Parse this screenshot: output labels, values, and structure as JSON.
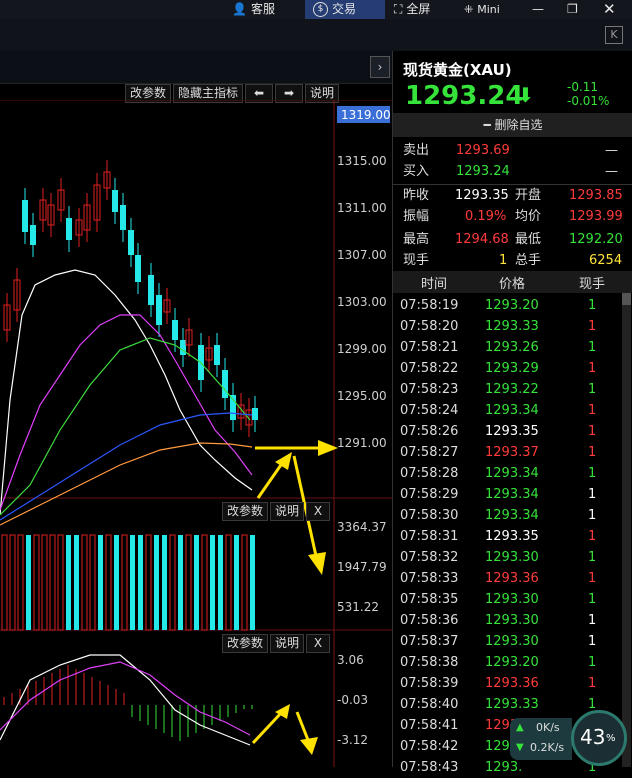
{
  "topbar": {
    "service_label": "客服",
    "trade_label": "交易",
    "fullscreen_label": "全屏",
    "mini_label": "Mini"
  },
  "chart": {
    "toolbar": {
      "params": "改参数",
      "hide_indicator": "隐藏主指标",
      "help": "说明"
    },
    "price_ticks": [
      "1319.00",
      "1315.00",
      "1311.00",
      "1307.00",
      "1303.00",
      "1299.00",
      "1295.00",
      "1291.00"
    ],
    "volume_toolbar": {
      "params": "改参数",
      "help": "说明",
      "close": "X"
    },
    "volume_ticks": [
      "3364.37",
      "1947.79",
      "531.22"
    ],
    "macd_toolbar": {
      "params": "改参数",
      "help": "说明",
      "close": "X"
    },
    "macd_ticks": [
      "3.06",
      "-0.03",
      "-3.12"
    ]
  },
  "quote": {
    "name": "现货黄金(XAU)",
    "price": "1293.24",
    "change": "-0.11",
    "change_pct": "-0.01%",
    "remove_watch": "删除自选",
    "ask_label": "卖出",
    "ask": "1293.69",
    "ask_vol": "—",
    "bid_label": "买入",
    "bid": "1293.24",
    "bid_vol": "—",
    "prev_close_label": "昨收",
    "prev_close": "1293.35",
    "open_label": "开盘",
    "open": "1293.85",
    "amplitude_label": "振幅",
    "amplitude": "0.19%",
    "avg_label": "均价",
    "avg": "1293.99",
    "high_label": "最高",
    "high": "1294.68",
    "low_label": "最低",
    "low": "1292.20",
    "cur_vol_label": "现手",
    "cur_vol": "1",
    "total_vol_label": "总手",
    "total_vol": "6254"
  },
  "trades": {
    "headers": [
      "时间",
      "价格",
      "现手"
    ],
    "rows": [
      {
        "time": "07:58:19",
        "price": "1293.20",
        "vol": "1",
        "pc": "grn",
        "vc": "grn"
      },
      {
        "time": "07:58:20",
        "price": "1293.33",
        "vol": "1",
        "pc": "grn",
        "vc": "red"
      },
      {
        "time": "07:58:21",
        "price": "1293.26",
        "vol": "1",
        "pc": "grn",
        "vc": "grn"
      },
      {
        "time": "07:58:22",
        "price": "1293.29",
        "vol": "1",
        "pc": "grn",
        "vc": "red"
      },
      {
        "time": "07:58:23",
        "price": "1293.22",
        "vol": "1",
        "pc": "grn",
        "vc": "grn"
      },
      {
        "time": "07:58:24",
        "price": "1293.34",
        "vol": "1",
        "pc": "grn",
        "vc": "red"
      },
      {
        "time": "07:58:26",
        "price": "1293.35",
        "vol": "1",
        "pc": "wht",
        "vc": "red"
      },
      {
        "time": "07:58:27",
        "price": "1293.37",
        "vol": "1",
        "pc": "red",
        "vc": "red"
      },
      {
        "time": "07:58:28",
        "price": "1293.34",
        "vol": "1",
        "pc": "grn",
        "vc": "grn"
      },
      {
        "time": "07:58:29",
        "price": "1293.34",
        "vol": "1",
        "pc": "grn",
        "vc": "wht"
      },
      {
        "time": "07:58:30",
        "price": "1293.34",
        "vol": "1",
        "pc": "grn",
        "vc": "wht"
      },
      {
        "time": "07:58:31",
        "price": "1293.35",
        "vol": "1",
        "pc": "wht",
        "vc": "red"
      },
      {
        "time": "07:58:32",
        "price": "1293.30",
        "vol": "1",
        "pc": "grn",
        "vc": "grn"
      },
      {
        "time": "07:58:33",
        "price": "1293.36",
        "vol": "1",
        "pc": "red",
        "vc": "red"
      },
      {
        "time": "07:58:35",
        "price": "1293.30",
        "vol": "1",
        "pc": "grn",
        "vc": "grn"
      },
      {
        "time": "07:58:36",
        "price": "1293.30",
        "vol": "1",
        "pc": "grn",
        "vc": "wht"
      },
      {
        "time": "07:58:37",
        "price": "1293.30",
        "vol": "1",
        "pc": "grn",
        "vc": "wht"
      },
      {
        "time": "07:58:38",
        "price": "1293.20",
        "vol": "1",
        "pc": "grn",
        "vc": "grn"
      },
      {
        "time": "07:58:39",
        "price": "1293.36",
        "vol": "1",
        "pc": "red",
        "vc": "red"
      },
      {
        "time": "07:58:40",
        "price": "1293.33",
        "vol": "1",
        "pc": "grn",
        "vc": "grn"
      },
      {
        "time": "07:58:41",
        "price": "1293.37",
        "vol": "",
        "pc": "red",
        "vc": "red"
      },
      {
        "time": "07:58:42",
        "price": "1293.",
        "vol": "1",
        "pc": "grn",
        "vc": "red"
      },
      {
        "time": "07:58:43",
        "price": "1293.",
        "vol": "1",
        "pc": "grn",
        "vc": "grn"
      }
    ]
  },
  "speed": {
    "up": "0K/s",
    "down": "0.2K/s",
    "percent": "43",
    "percent_sign": "%"
  }
}
